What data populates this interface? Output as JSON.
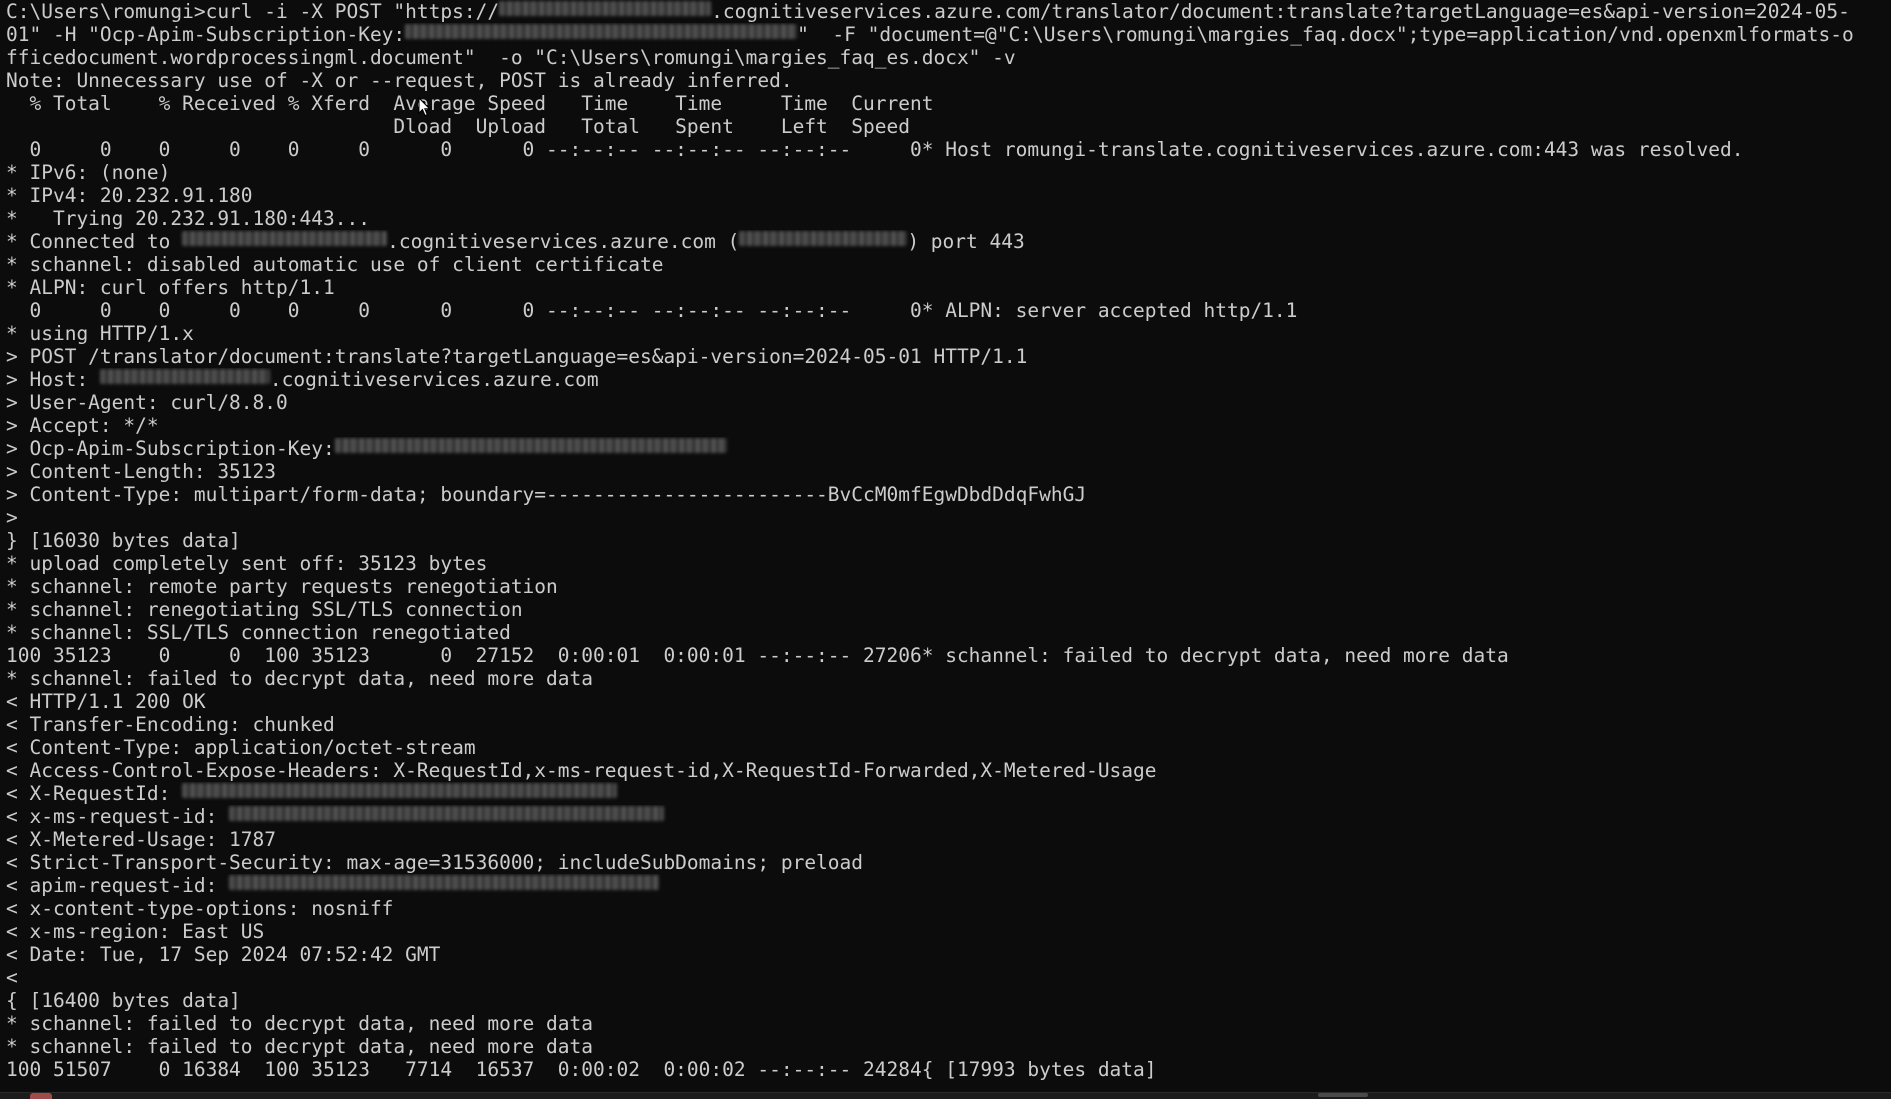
{
  "window": {
    "type": "terminal"
  },
  "lines": [
    [
      {
        "t": "C:\\Users\\romungi>curl -i -X POST \"https://"
      },
      {
        "r": "romungi-translate",
        "w": 212
      },
      {
        "t": ".cognitiveservices.azure.com/translator/document:translate?targetLanguage=es&api-version=2024-05-"
      }
    ],
    [
      {
        "t": "01\" -H \"Ocp-Apim-Subscription-Key:"
      },
      {
        "r": "subscription-key",
        "w": 392
      },
      {
        "t": "\"  -F \"document=@\"C:\\Users\\romungi\\margies_faq.docx\";type=application/vnd.openxmlformats-o"
      }
    ],
    [
      {
        "t": "fficedocument.wordprocessingml.document\"  -o \"C:\\Users\\romungi\\margies_faq_es.docx\" -v"
      }
    ],
    [
      {
        "t": "Note: Unnecessary use of -X or --request, POST is already inferred."
      }
    ],
    [
      {
        "t": "  % Total    % Received % Xferd  Average Speed   Time    Time     Time  Current"
      }
    ],
    [
      {
        "t": "                                 Dload  Upload   Total   Spent    Left  Speed"
      }
    ],
    [
      {
        "t": "  0     0    0     0    0     0      0      0 --:--:-- --:--:-- --:--:--     0* Host romungi-translate.cognitiveservices.azure.com:443 was resolved."
      }
    ],
    [
      {
        "t": "* IPv6: (none)"
      }
    ],
    [
      {
        "t": "* IPv4: 20.232.91.180"
      }
    ],
    [
      {
        "t": "*   Trying 20.232.91.180:443..."
      }
    ],
    [
      {
        "t": "* Connected to "
      },
      {
        "r": "romungi-translate",
        "w": 205
      },
      {
        "t": ".cognitiveservices.azure.com ("
      },
      {
        "r": "20.232.91.180",
        "w": 168
      },
      {
        "t": ") port 443"
      }
    ],
    [
      {
        "t": "* schannel: disabled automatic use of client certificate"
      }
    ],
    [
      {
        "t": "* ALPN: curl offers http/1.1"
      }
    ],
    [
      {
        "t": "  0     0    0     0    0     0      0      0 --:--:-- --:--:-- --:--:--     0* ALPN: server accepted http/1.1"
      }
    ],
    [
      {
        "t": "* using HTTP/1.x"
      }
    ],
    [
      {
        "t": "> POST /translator/document:translate?targetLanguage=es&api-version=2024-05-01 HTTP/1.1"
      }
    ],
    [
      {
        "t": "> Host: "
      },
      {
        "r": "romungi-translate",
        "w": 170
      },
      {
        "t": ".cognitiveservices.azure.com"
      }
    ],
    [
      {
        "t": "> User-Agent: curl/8.8.0"
      }
    ],
    [
      {
        "t": "> Accept: */*"
      }
    ],
    [
      {
        "t": "> Ocp-Apim-Subscription-Key:"
      },
      {
        "r": "subscription-key",
        "w": 392
      }
    ],
    [
      {
        "t": "> Content-Length: 35123"
      }
    ],
    [
      {
        "t": "> Content-Type: multipart/form-data; boundary=------------------------BvCcM0mfEgwDbdDdqFwhGJ"
      }
    ],
    [
      {
        "t": ">"
      }
    ],
    [
      {
        "t": "} [16030 bytes data]"
      }
    ],
    [
      {
        "t": "* upload completely sent off: 35123 bytes"
      }
    ],
    [
      {
        "t": "* schannel: remote party requests renegotiation"
      }
    ],
    [
      {
        "t": "* schannel: renegotiating SSL/TLS connection"
      }
    ],
    [
      {
        "t": "* schannel: SSL/TLS connection renegotiated"
      }
    ],
    [
      {
        "t": "100 35123    0     0  100 35123      0  27152  0:00:01  0:00:01 --:--:-- 27206* schannel: failed to decrypt data, need more data"
      }
    ],
    [
      {
        "t": "* schannel: failed to decrypt data, need more data"
      }
    ],
    [
      {
        "t": "< HTTP/1.1 200 OK"
      }
    ],
    [
      {
        "t": "< Transfer-Encoding: chunked"
      }
    ],
    [
      {
        "t": "< Content-Type: application/octet-stream"
      }
    ],
    [
      {
        "t": "< Access-Control-Expose-Headers: X-RequestId,x-ms-request-id,X-RequestId-Forwarded,X-Metered-Usage"
      }
    ],
    [
      {
        "t": "< X-RequestId: "
      },
      {
        "r": "request-id",
        "w": 435
      }
    ],
    [
      {
        "t": "< x-ms-request-id: "
      },
      {
        "r": "request-id",
        "w": 435
      }
    ],
    [
      {
        "t": "< X-Metered-Usage: 1787"
      }
    ],
    [
      {
        "t": "< Strict-Transport-Security: max-age=31536000; includeSubDomains; preload"
      }
    ],
    [
      {
        "t": "< apim-request-id: "
      },
      {
        "r": "request-id",
        "w": 430
      }
    ],
    [
      {
        "t": "< x-content-type-options: nosniff"
      }
    ],
    [
      {
        "t": "< x-ms-region: East US"
      }
    ],
    [
      {
        "t": "< Date: Tue, 17 Sep 2024 07:52:42 GMT"
      }
    ],
    [
      {
        "t": "<"
      }
    ],
    [
      {
        "t": "{ [16400 bytes data]"
      }
    ],
    [
      {
        "t": "* schannel: failed to decrypt data, need more data"
      }
    ],
    [
      {
        "t": "* schannel: failed to decrypt data, need more data"
      }
    ],
    [
      {
        "t": "100 51507    0 16384  100 35123   7714  16537  0:00:02  0:00:02 --:--:-- 24284{ [17993 bytes data]"
      }
    ]
  ],
  "colors": {
    "background": "#0c0c0c",
    "foreground": "#cccccc"
  },
  "icons": {
    "cursor": "mouse-pointer-icon"
  }
}
